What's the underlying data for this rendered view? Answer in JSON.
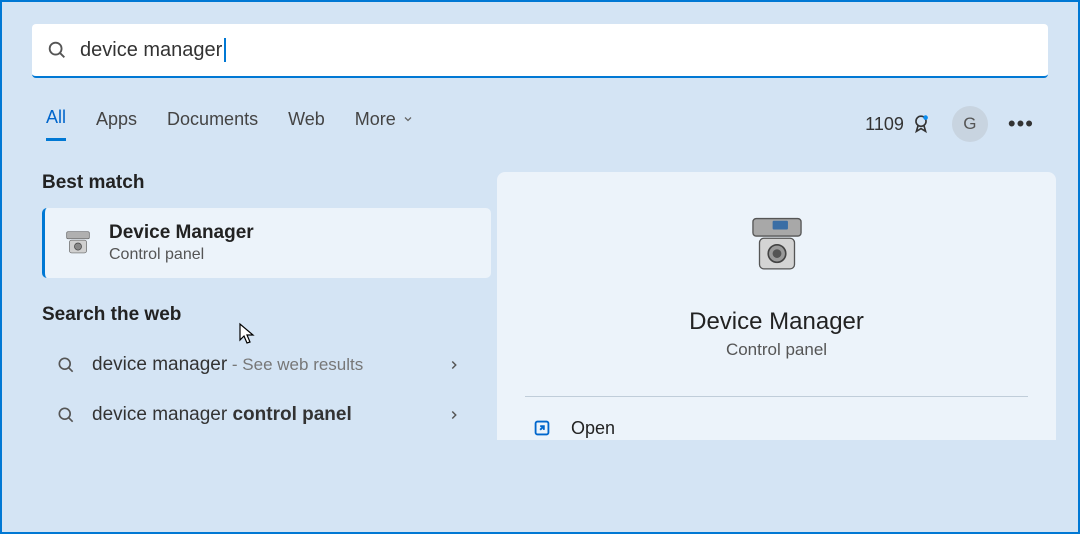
{
  "search": {
    "query": "device manager"
  },
  "filters": {
    "all": "All",
    "apps": "Apps",
    "documents": "Documents",
    "web": "Web",
    "more": "More"
  },
  "rewards": {
    "points": "1109"
  },
  "profile": {
    "initial": "G"
  },
  "left": {
    "best_match_label": "Best match",
    "result": {
      "title": "Device Manager",
      "subtitle": "Control panel"
    },
    "web_label": "Search the web",
    "web_items": [
      {
        "main": "device manager",
        "suffix": " - See web results"
      },
      {
        "main": "device manager ",
        "bold": "control panel"
      }
    ]
  },
  "right": {
    "title": "Device Manager",
    "subtitle": "Control panel",
    "action_open": "Open"
  }
}
